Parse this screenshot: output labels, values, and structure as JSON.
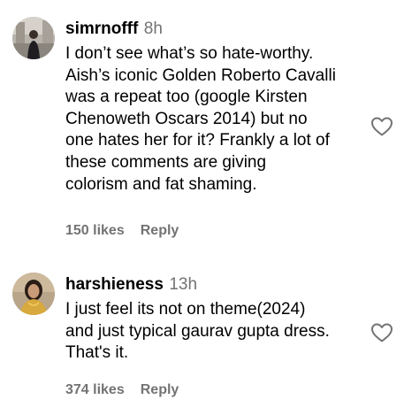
{
  "comments": [
    {
      "username": "simrnofff",
      "time": "8h",
      "lines": [
        "I don’t see what’s so hate-worthy.",
        "Aish’s iconic Golden Roberto Cavalli",
        "was a repeat too (google Kirsten",
        "Chenoweth Oscars 2014) but no",
        "one hates her for it? Frankly a lot of",
        "these comments are giving",
        "colorism and fat shaming."
      ],
      "likes": "150 likes",
      "reply_label": "Reply",
      "like_icon": "heart-outline-icon"
    },
    {
      "username": "harshieness",
      "time": "13h",
      "lines": [
        "I just feel its not on theme(2024)",
        "and just typical gaurav gupta dress.",
        "That's it."
      ],
      "likes": "374 likes",
      "reply_label": "Reply",
      "like_icon": "heart-outline-icon"
    }
  ],
  "colors": {
    "text": "#000000",
    "secondary": "#737373",
    "background": "#ffffff"
  }
}
